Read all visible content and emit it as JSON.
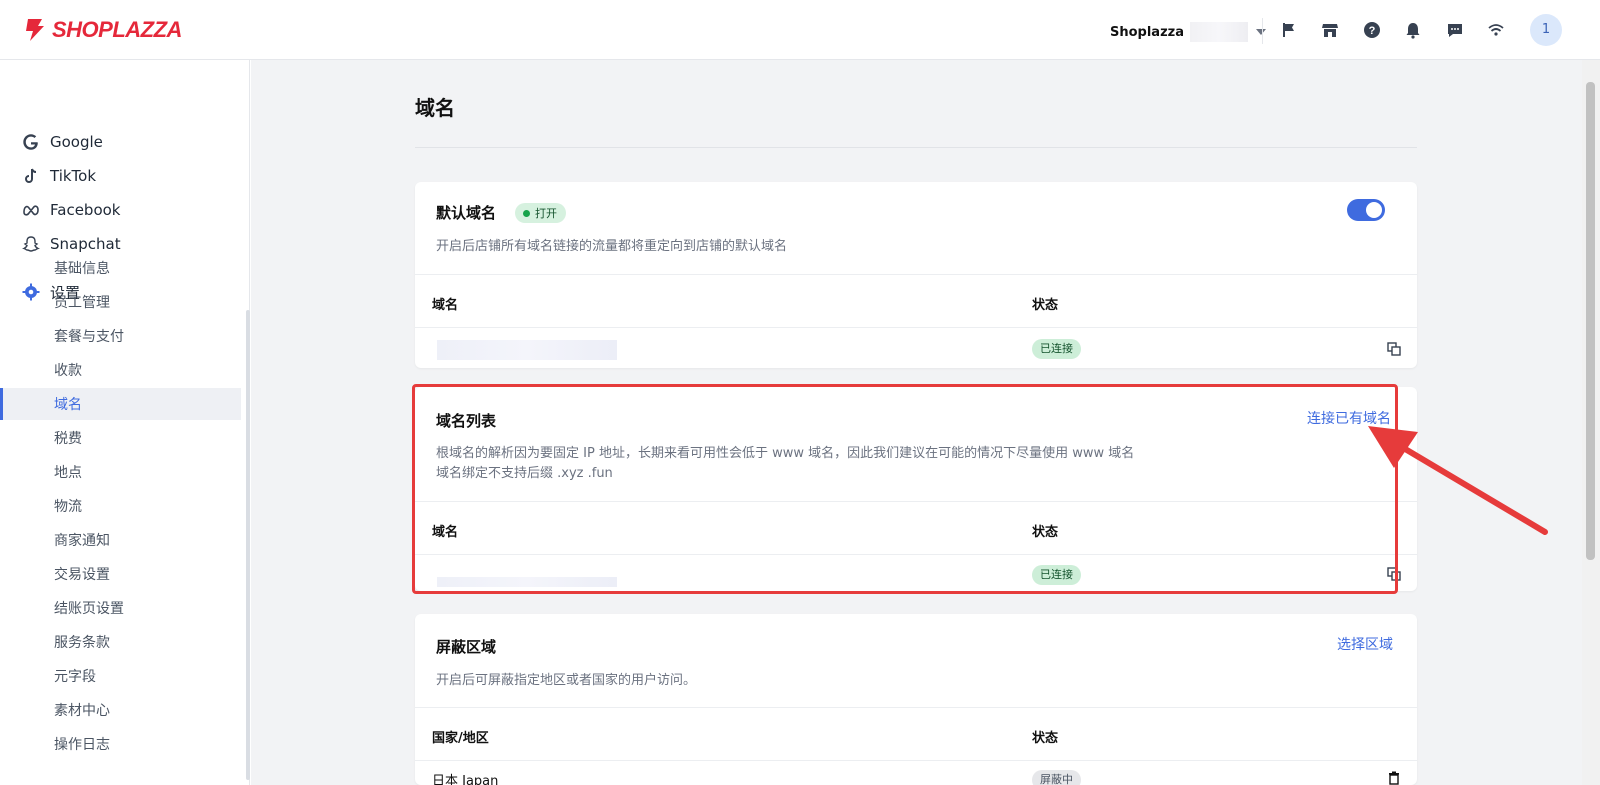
{
  "brand": {
    "name": "SHOPLAZZA",
    "color": "#e5283a"
  },
  "topbar": {
    "store_name": "Shoplazza",
    "icons": [
      "flag-icon",
      "store-icon",
      "help-icon",
      "bell-icon",
      "chat-icon",
      "wifi-icon"
    ],
    "avatar_label": "1"
  },
  "sidebar": {
    "channels": [
      {
        "label": "Google",
        "icon": "google-icon"
      },
      {
        "label": "TikTok",
        "icon": "tiktok-icon"
      },
      {
        "label": "Facebook",
        "icon": "meta-icon"
      },
      {
        "label": "Snapchat",
        "icon": "snapchat-icon"
      }
    ],
    "settings_label": "设置",
    "settings_items": [
      "基础信息",
      "员工管理",
      "套餐与支付",
      "收款",
      "域名",
      "税费",
      "地点",
      "物流",
      "商家通知",
      "交易设置",
      "结账页设置",
      "服务条款",
      "元字段",
      "素材中心",
      "操作日志"
    ],
    "active_item": "域名"
  },
  "page": {
    "title": "域名",
    "default_domain": {
      "title": "默认域名",
      "badge": "打开",
      "toggle_on": true,
      "description": "开启后店铺所有域名链接的流量都将重定向到店铺的默认域名",
      "col_domain": "域名",
      "col_status": "状态",
      "row_status": "已连接"
    },
    "domain_list": {
      "title": "域名列表",
      "action": "连接已有域名",
      "description_1": "根域名的解析因为要固定 IP 地址，长期来看可用性会低于 www 域名，因此我们建议在可能的情况下尽量使用 www 域名",
      "description_2": "域名绑定不支持后缀 .xyz .fun",
      "col_domain": "域名",
      "col_status": "状态",
      "row_status": "已连接"
    },
    "blocked_region": {
      "title": "屏蔽区域",
      "action": "选择区域",
      "description": "开启后可屏蔽指定地区或者国家的用户访问。",
      "col_region": "国家/地区",
      "col_status": "状态",
      "row_region": "日本 Japan",
      "row_status": "屏蔽中"
    }
  },
  "colors": {
    "accent": "#3f6bdf",
    "success_bg": "#cdeed8",
    "annotation": "#e63b3b"
  }
}
